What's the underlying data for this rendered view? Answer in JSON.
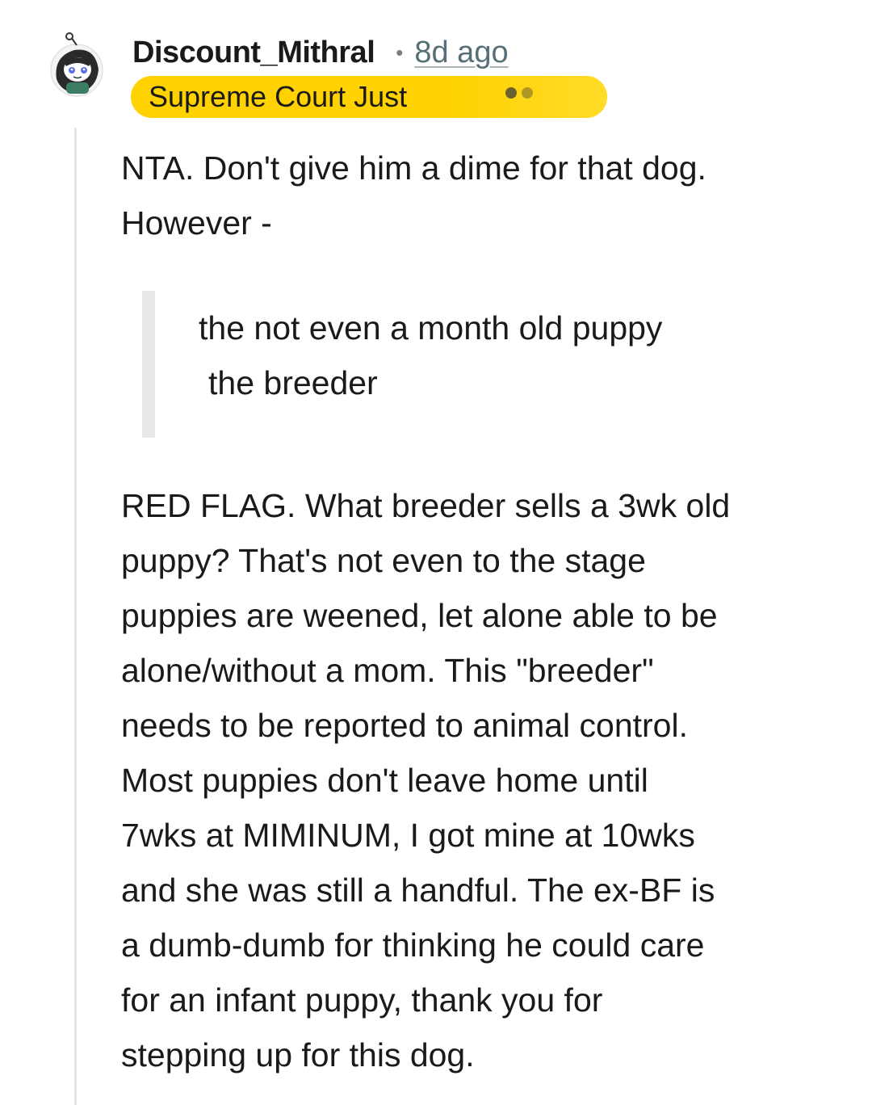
{
  "comment": {
    "username": "Discount_Mithral",
    "separator": "•",
    "timestamp": "8d ago",
    "flair": "Supreme Court Just",
    "avatar_icon": "snoo-avatar-icon",
    "flair_color": "#ffd200",
    "body": {
      "intro_lines": [
        "NTA. Don't give him a dime for that dog.",
        "However -"
      ],
      "quote_lines": [
        "the not even a month old puppy",
        "the breeder"
      ],
      "paragraph_lines": [
        "RED FLAG. What breeder sells a 3wk old",
        "puppy? That's not even to the stage",
        "puppies are weened, let alone able to be",
        "alone/without a mom. This \"breeder\"",
        "needs to be reported to animal control.",
        "Most puppies don't leave home until",
        "7wks at MIMINUM, I got mine at 10wks",
        "and she was still a handful. The ex-BF is",
        "a dumb-dumb for thinking he could care",
        "for an infant puppy, thank you for",
        "stepping up for this dog."
      ]
    }
  }
}
